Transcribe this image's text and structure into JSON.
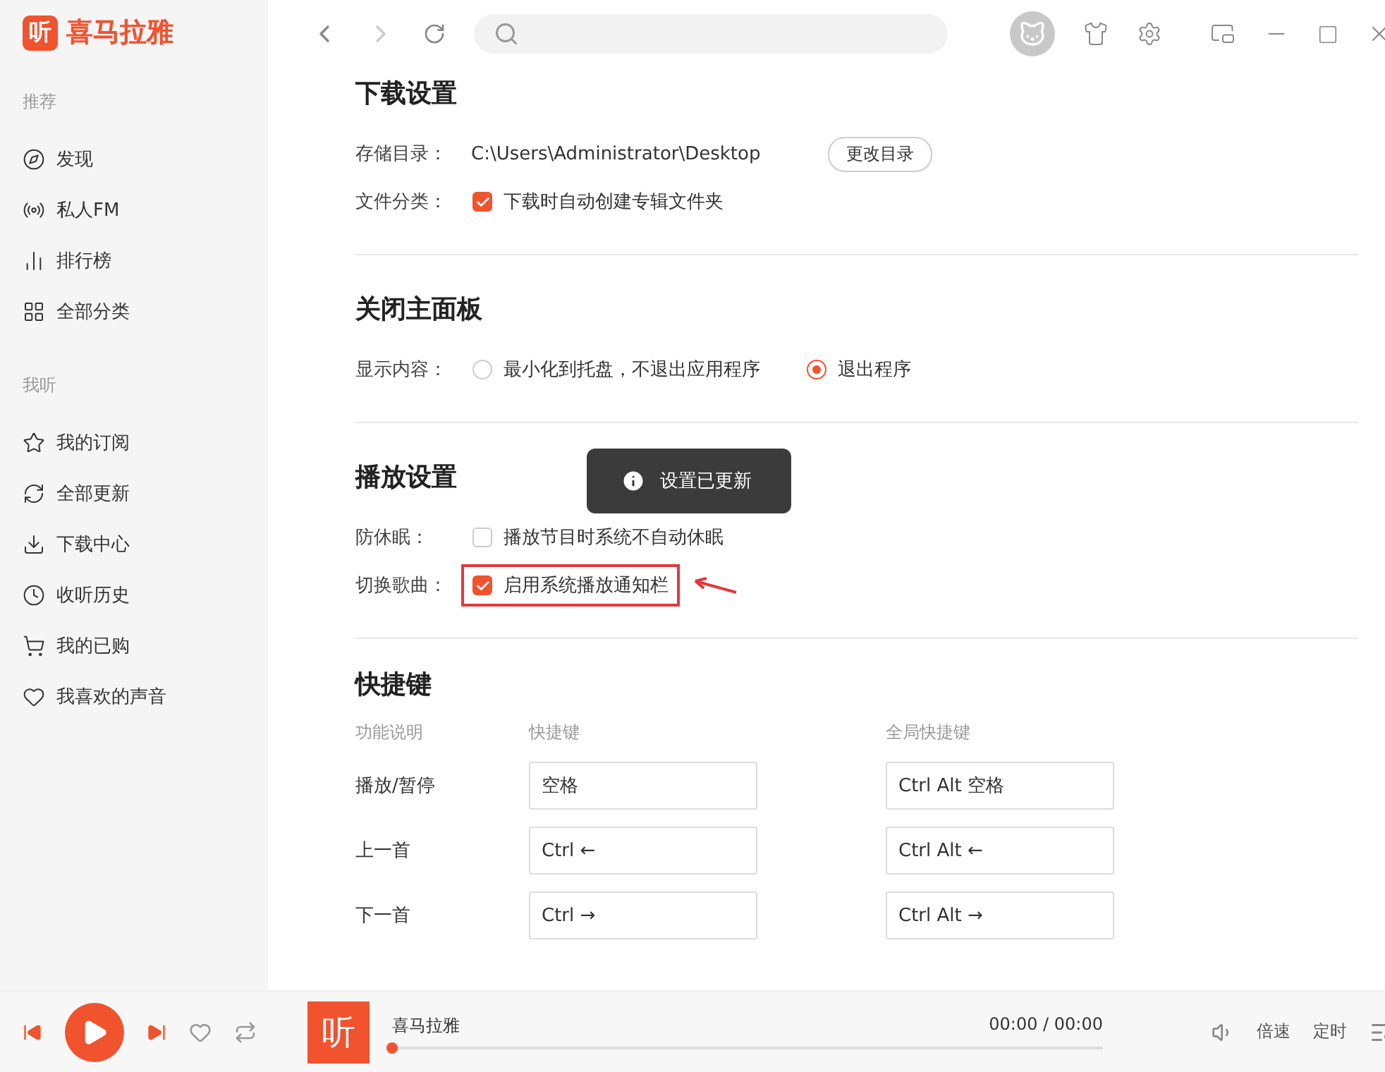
{
  "app": {
    "logo_mark": "听",
    "logo_text": "喜马拉雅"
  },
  "sidebar": {
    "sections": [
      {
        "title": "推荐",
        "items": [
          {
            "label": "发现",
            "selected": false
          },
          {
            "label": "私人FM",
            "selected": false
          },
          {
            "label": "排行榜",
            "selected": false
          },
          {
            "label": "全部分类",
            "selected": false
          }
        ]
      },
      {
        "title": "我听",
        "items": [
          {
            "label": "我的订阅",
            "selected": false
          },
          {
            "label": "全部更新",
            "selected": false
          },
          {
            "label": "下载中心",
            "selected": false
          },
          {
            "label": "收听历史",
            "selected": false
          },
          {
            "label": "我的已购",
            "selected": false
          },
          {
            "label": "我喜欢的声音",
            "selected": false
          }
        ]
      }
    ]
  },
  "settings": [
    {
      "title": "下载设置",
      "rows": [
        {
          "label": "存储目录：",
          "kind": "path",
          "value": "C:\\Users\\Administrator\\Desktop",
          "button": "更改目录"
        },
        {
          "label": "文件分类：",
          "kind": "checkbox",
          "options": [
            {
              "text": "下载时自动创建专辑文件夹",
              "checked": true
            }
          ]
        }
      ]
    },
    {
      "title": "关闭主面板",
      "rows": [
        {
          "label": "显示内容：",
          "kind": "radio",
          "options": [
            {
              "text": "最小化到托盘，不退出应用程序",
              "selected": false
            },
            {
              "text": "退出程序",
              "selected": true
            }
          ]
        }
      ]
    },
    {
      "title": "播放设置",
      "rows": [
        {
          "label": "防休眠：",
          "kind": "checkbox",
          "options": [
            {
              "text": "播放节目时系统不自动休眠",
              "checked": false
            }
          ]
        },
        {
          "label": "切换歌曲：",
          "kind": "checkbox",
          "highlighted": true,
          "options": [
            {
              "text": "启用系统播放通知栏",
              "checked": true
            }
          ]
        }
      ]
    }
  ],
  "shortcuts": {
    "title": "快捷键",
    "columns": [
      "功能说明",
      "快捷键",
      "全局快捷键"
    ],
    "rows": [
      {
        "action": "播放/暂停",
        "key": "空格",
        "global": "Ctrl Alt 空格"
      },
      {
        "action": "上一首",
        "key": "Ctrl ←",
        "global": "Ctrl Alt ←"
      },
      {
        "action": "下一首",
        "key": "Ctrl →",
        "global": "Ctrl Alt →"
      }
    ]
  },
  "toast": {
    "text": "设置已更新"
  },
  "player": {
    "cover_mark": "听",
    "title": "喜马拉雅",
    "time": "00:00 / 00:00",
    "level": 0,
    "speed": "倍速",
    "timer": "定时"
  }
}
